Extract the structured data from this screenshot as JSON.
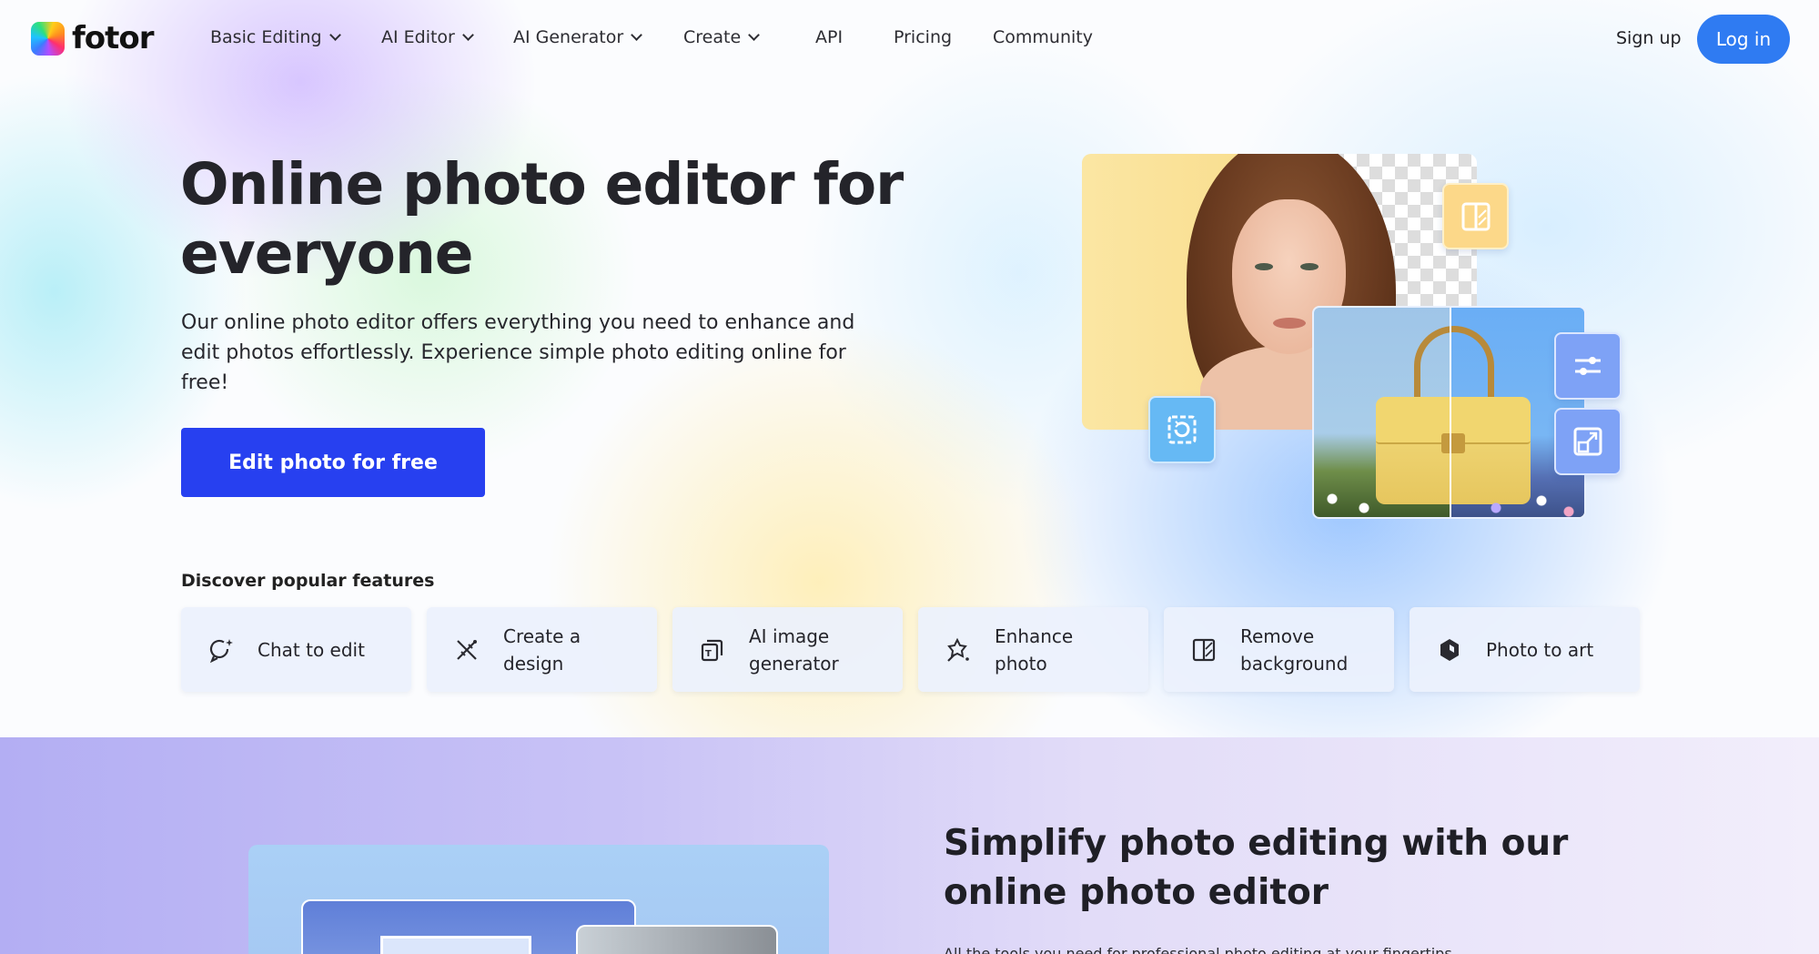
{
  "brand": {
    "name": "fotor"
  },
  "nav": {
    "items": [
      {
        "label": "Basic Editing",
        "dropdown": true
      },
      {
        "label": "AI Editor",
        "dropdown": true
      },
      {
        "label": "AI Generator",
        "dropdown": true
      },
      {
        "label": "Create",
        "dropdown": true
      },
      {
        "label": "API",
        "dropdown": false
      },
      {
        "label": "Pricing",
        "dropdown": false
      },
      {
        "label": "Community",
        "dropdown": false
      }
    ],
    "signup_label": "Sign up",
    "login_label": "Log in"
  },
  "hero": {
    "title": "Online photo editor for everyone",
    "description": "Our online photo editor offers everything you need to enhance and edit photos effortlessly. Experience simple photo editing online for free!",
    "cta_label": "Edit photo for free"
  },
  "features": {
    "heading": "Discover popular features",
    "items": [
      {
        "label": "Chat to edit",
        "icon": "chat-sparkle-icon"
      },
      {
        "label": "Create a design",
        "icon": "design-tools-icon"
      },
      {
        "label": "AI image generator",
        "icon": "ai-image-icon"
      },
      {
        "label": "Enhance photo",
        "icon": "magic-enhance-icon"
      },
      {
        "label": "Remove background",
        "icon": "remove-background-icon"
      },
      {
        "label": "Photo to art",
        "icon": "photo-to-art-icon"
      }
    ]
  },
  "illustration": {
    "icons": [
      "compare-icon",
      "rotate-crop-icon",
      "adjust-sliders-icon",
      "resize-icon"
    ]
  },
  "section2": {
    "title": "Simplify photo editing with our online photo editor",
    "subtitle": "All the tools you need for professional photo editing at your fingertips"
  },
  "colors": {
    "accent_blue": "#2740f0",
    "login_blue": "#2f7bf2",
    "text_dark": "#24242a"
  }
}
